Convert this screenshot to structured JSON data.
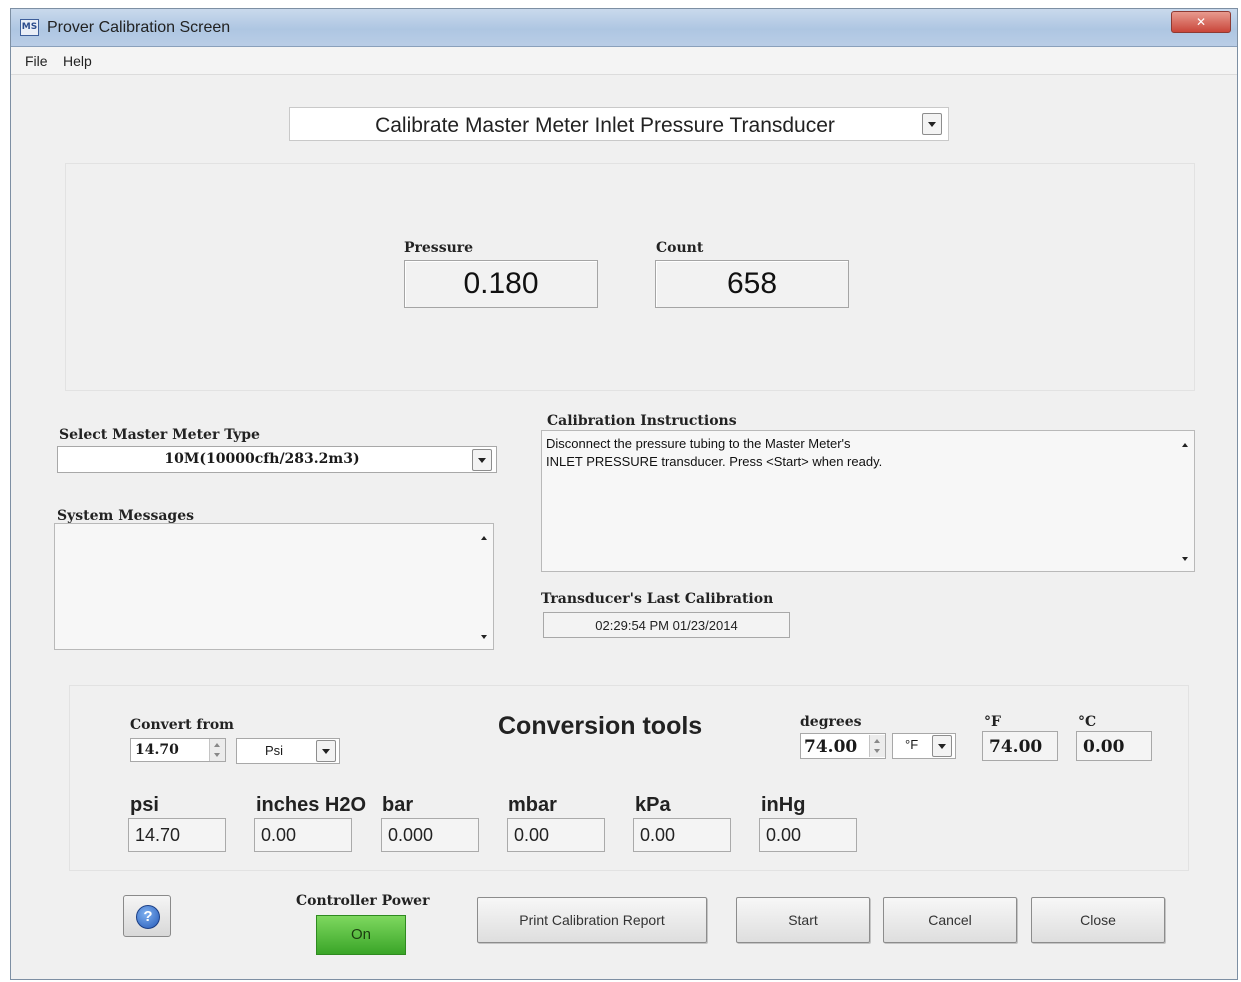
{
  "window": {
    "title": "Prover Calibration Screen",
    "icon_text": "MS"
  },
  "menu": [
    "File",
    "Help"
  ],
  "mode_select": {
    "value": "Calibrate Master Meter Inlet Pressure Transducer"
  },
  "readouts": {
    "pressure_label": "Pressure",
    "pressure_value": "0.180",
    "count_label": "Count",
    "count_value": "658"
  },
  "meter_type": {
    "label": "Select Master Meter Type",
    "value": "10M(10000cfh/283.2m3)"
  },
  "system_messages": {
    "label": "System Messages",
    "text": ""
  },
  "instructions": {
    "label": "Calibration Instructions",
    "line1": "Disconnect the pressure tubing to the Master Meter's",
    "line2": "INLET PRESSURE transducer. Press <Start> when ready."
  },
  "last_calibration": {
    "label": "Transducer's Last Calibration",
    "value": "02:29:54 PM  01/23/2014"
  },
  "conversion": {
    "title": "Conversion tools",
    "convert_from_label": "Convert from",
    "convert_from_value": "14.70",
    "convert_from_unit": "Psi",
    "degrees_label": "degrees",
    "degrees_value": "74.00",
    "degrees_unit": "°F",
    "f_label": "°F",
    "f_value": "74.00",
    "c_label": "°C",
    "c_value": "0.00",
    "units": [
      {
        "label": "psi",
        "value": "14.70"
      },
      {
        "label": "inches H2O",
        "value": "0.00"
      },
      {
        "label": "bar",
        "value": "0.000"
      },
      {
        "label": "mbar",
        "value": "0.00"
      },
      {
        "label": "kPa",
        "value": "0.00"
      },
      {
        "label": "inHg",
        "value": "0.00"
      }
    ]
  },
  "controller_power": {
    "label": "Controller Power",
    "state": "On"
  },
  "buttons": {
    "help": "?",
    "print": "Print Calibration Report",
    "start": "Start",
    "cancel": "Cancel",
    "close": "Close"
  },
  "colors": {
    "power_on": "#3aa528",
    "titlebar": "#aec6e2"
  }
}
